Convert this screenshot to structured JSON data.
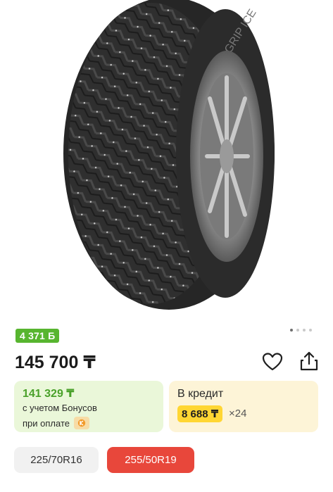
{
  "gallery": {
    "image_alt": "tire-photo",
    "pager_total": 4,
    "pager_active": 0
  },
  "bonus_badge": "4 371 Б",
  "price": "145 700 ₸",
  "bonus_card": {
    "price": "141 329 ₸",
    "line1": "с учетом Бонусов",
    "line2": "при оплате"
  },
  "credit_card": {
    "title": "В кредит",
    "monthly": "8 688 ₸",
    "months": "×24"
  },
  "sizes": [
    "225/70R16",
    "255/50R19"
  ],
  "selected_size": "255/50R19",
  "colors": {
    "bonus_green": "#57b52f",
    "credit_yellow": "#ffd633",
    "chip_selected": "#e8473b"
  }
}
